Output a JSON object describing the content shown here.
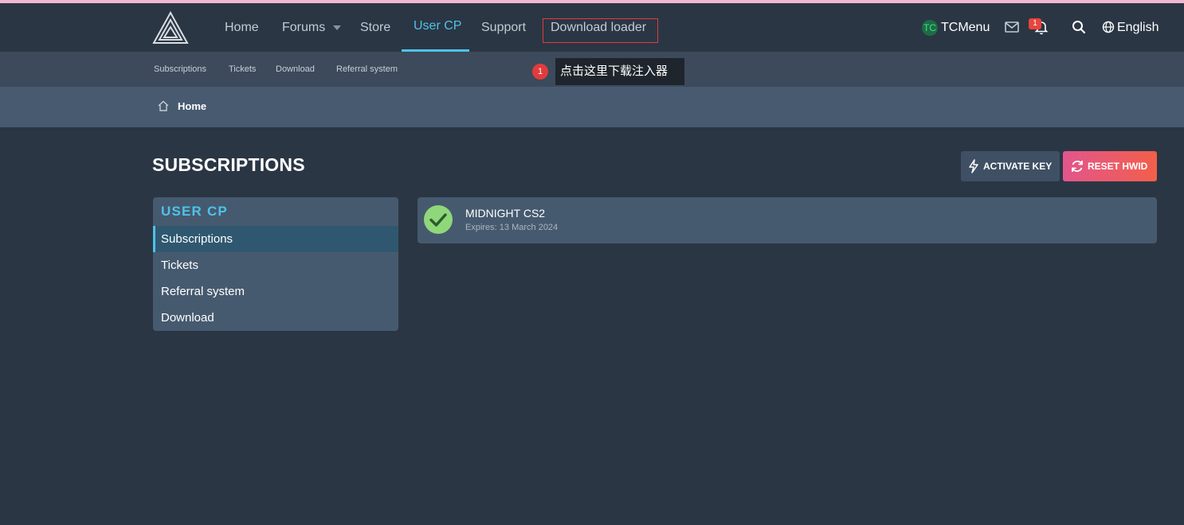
{
  "nav": {
    "items": [
      {
        "label": "Home"
      },
      {
        "label": "Forums"
      },
      {
        "label": "Store"
      },
      {
        "label": "User CP"
      },
      {
        "label": "Support"
      },
      {
        "label": "Download loader"
      }
    ],
    "active": "User CP"
  },
  "user": {
    "initials": "TC",
    "name": "TCMenu"
  },
  "notifications": {
    "count": "1"
  },
  "language": "English",
  "subnav": {
    "items": [
      {
        "label": "Subscriptions"
      },
      {
        "label": "Tickets"
      },
      {
        "label": "Download"
      },
      {
        "label": "Referral system"
      }
    ]
  },
  "annotation": {
    "number": "1",
    "text": "点击这里下载注入器"
  },
  "breadcrumb": {
    "label": "Home"
  },
  "page": {
    "title": "SUBSCRIPTIONS"
  },
  "actions": {
    "activate_label": "ACTIVATE KEY",
    "reset_label": "RESET HWID"
  },
  "sidebar": {
    "header": "USER CP",
    "items": [
      {
        "label": "Subscriptions"
      },
      {
        "label": "Tickets"
      },
      {
        "label": "Referral system"
      },
      {
        "label": "Download"
      }
    ],
    "active": "Subscriptions"
  },
  "subscriptions": [
    {
      "name": "MIDNIGHT CS2",
      "expires": "Expires: 13 March 2024",
      "status": "active"
    }
  ],
  "colors": {
    "accent": "#4dc3e8",
    "background": "#2b3644",
    "success": "#8fd87a",
    "reset_gradient_start": "#e2568c",
    "reset_gradient_end": "#f25f4a",
    "annotation_red": "#e23b3b"
  },
  "icons": [
    "logo-triangle-icon",
    "chevron-down-icon",
    "mail-icon",
    "bell-icon",
    "search-icon",
    "globe-icon",
    "home-icon",
    "bolt-icon",
    "refresh-icon",
    "check-icon"
  ]
}
